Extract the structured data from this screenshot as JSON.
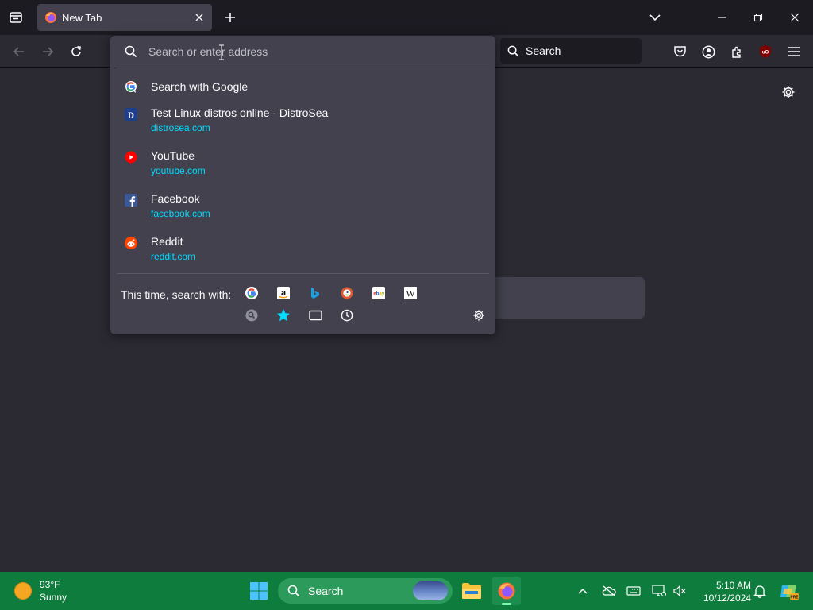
{
  "tabs": [
    {
      "title": "New Tab"
    }
  ],
  "navbar": {
    "search_placeholder": "Search"
  },
  "urlbar": {
    "placeholder": "Search or enter address",
    "value": ""
  },
  "results": [
    {
      "title": "Search with Google",
      "url": "",
      "icon": "google-icon"
    },
    {
      "title": "Test Linux distros online - DistroSea",
      "url": "distrosea.com",
      "icon": "distrosea-icon"
    },
    {
      "title": "YouTube",
      "url": "youtube.com",
      "icon": "youtube-icon"
    },
    {
      "title": "Facebook",
      "url": "facebook.com",
      "icon": "facebook-icon"
    },
    {
      "title": "Reddit",
      "url": "reddit.com",
      "icon": "reddit-icon"
    }
  ],
  "oneoff": {
    "label": "This time, search with:",
    "engines": [
      "google-icon",
      "amazon-icon",
      "bing-icon",
      "duckduckgo-icon",
      "ebay-icon",
      "wikipedia-icon"
    ],
    "modes": [
      "search-shortcut-icon",
      "bookmarks-icon",
      "tabs-icon",
      "history-icon"
    ]
  },
  "taskbar": {
    "weather_temp": "93°F",
    "weather_desc": "Sunny",
    "search_label": "Search",
    "time": "5:10 AM",
    "date": "10/12/2024"
  },
  "colors": {
    "accent_url": "#00ddff",
    "taskbar": "#0d7c3c",
    "panel": "#42414d",
    "toolbar": "#2b2a33"
  }
}
